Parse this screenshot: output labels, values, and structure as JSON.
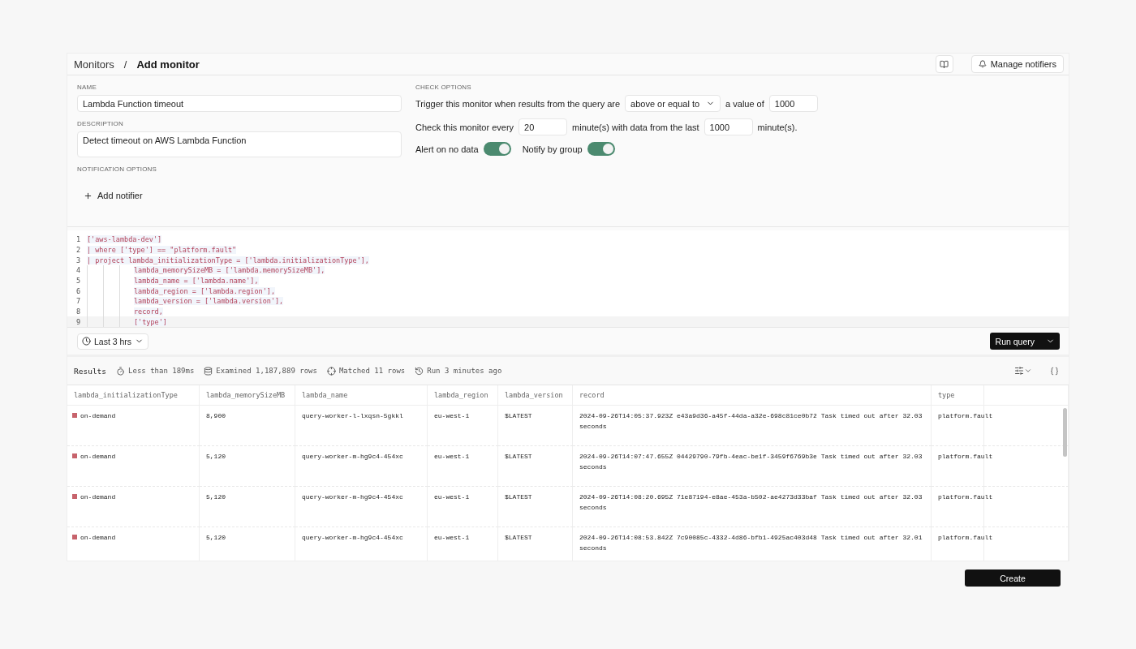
{
  "breadcrumb": [
    "Monitors",
    "Add monitor"
  ],
  "breadcrumb_separator": "/",
  "header_buttons": {
    "manage": "Manage notifiers"
  },
  "name": {
    "label": "NAME",
    "value": "Lambda Function timeout"
  },
  "description": {
    "label": "DESCRIPTION",
    "value": "Detect timeout on AWS Lambda Function"
  },
  "notification_options": {
    "label": "NOTIFICATION OPTIONS",
    "add": "Add notifier"
  },
  "check_options": {
    "label": "CHECK OPTIONS",
    "trigger_text": "Trigger this monitor when results from the query are",
    "operator": "above or equal to",
    "value_text": "a value of",
    "value": "1000",
    "every_text": "Check this monitor every",
    "every": "20",
    "window_text": "minute(s) with data from the last",
    "window": "1000",
    "unit_text": "minute(s).",
    "toggles": [
      {
        "label": "Alert on no data",
        "on": true
      },
      {
        "label": "Notify by group",
        "on": true
      }
    ]
  },
  "code_lines": [
    {
      "number": "1",
      "text": "['aws-lambda-dev']",
      "indented": false
    },
    {
      "number": "2",
      "text": "| where ['type'] == \"platform.fault\"",
      "indented": false
    },
    {
      "number": "3",
      "text": "| project lambda_initializationType = ['lambda.initializationType'],",
      "indented": false
    },
    {
      "number": "4",
      "text": "lambda_memorySizeMB = ['lambda.memorySizeMB'],",
      "indented": true
    },
    {
      "number": "5",
      "text": "lambda_name = ['lambda.name'],",
      "indented": true
    },
    {
      "number": "6",
      "text": "lambda_region = ['lambda.region'],",
      "indented": true
    },
    {
      "number": "7",
      "text": "lambda_version = ['lambda.version'],",
      "indented": true
    },
    {
      "number": "8",
      "text": "record,",
      "indented": true
    },
    {
      "number": "9",
      "text": "['type']",
      "indented": true
    }
  ],
  "time_range": "Last 3 hrs",
  "run_button": "Run query",
  "results_bar": {
    "title": "Results",
    "stats": [
      {
        "kind": "time",
        "text": "Less than 189ms"
      },
      {
        "kind": "rows",
        "text": "Examined 1,187,889 rows"
      },
      {
        "kind": "match",
        "text": "Matched 11 rows"
      },
      {
        "kind": "history",
        "text": "Run 3 minutes ago"
      }
    ]
  },
  "table": {
    "columns": [
      "lambda_initializationType",
      "lambda_memorySizeMB",
      "lambda_name",
      "lambda_region",
      "lambda_version",
      "record",
      "type"
    ],
    "rows": [
      {
        "color": "#c7636c",
        "cells": [
          "on-demand",
          "8,900",
          "query-worker-l-lxqsn-5gkkl",
          "eu-west-1",
          "$LATEST",
          "2024-09-26T14:05:37.923Z e43a9d36-a45f-44da-a32e-698c81ce0b72 Task timed out after 32.03 seconds",
          "platform.fault"
        ]
      },
      {
        "color": "#c7636c",
        "cells": [
          "on-demand",
          "5,120",
          "query-worker-m-hg9c4-454xc",
          "eu-west-1",
          "$LATEST",
          "2024-09-26T14:07:47.655Z 04429790-79fb-4eac-be1f-3459f6769b3e Task timed out after 32.03 seconds",
          "platform.fault"
        ]
      },
      {
        "color": "#c7636c",
        "cells": [
          "on-demand",
          "5,120",
          "query-worker-m-hg9c4-454xc",
          "eu-west-1",
          "$LATEST",
          "2024-09-26T14:08:20.695Z 71e87194-e8ae-453a-b502-ae4273d33baf Task timed out after 32.03 seconds",
          "platform.fault"
        ]
      },
      {
        "color": "#c7636c",
        "cells": [
          "on-demand",
          "5,120",
          "query-worker-m-hg9c4-454xc",
          "eu-west-1",
          "$LATEST",
          "2024-09-26T14:08:53.842Z 7c90085c-4332-4d86-bfb1-4925ac403d48 Task timed out after 32.01 seconds",
          "platform.fault"
        ]
      }
    ]
  },
  "create_button": "Create"
}
